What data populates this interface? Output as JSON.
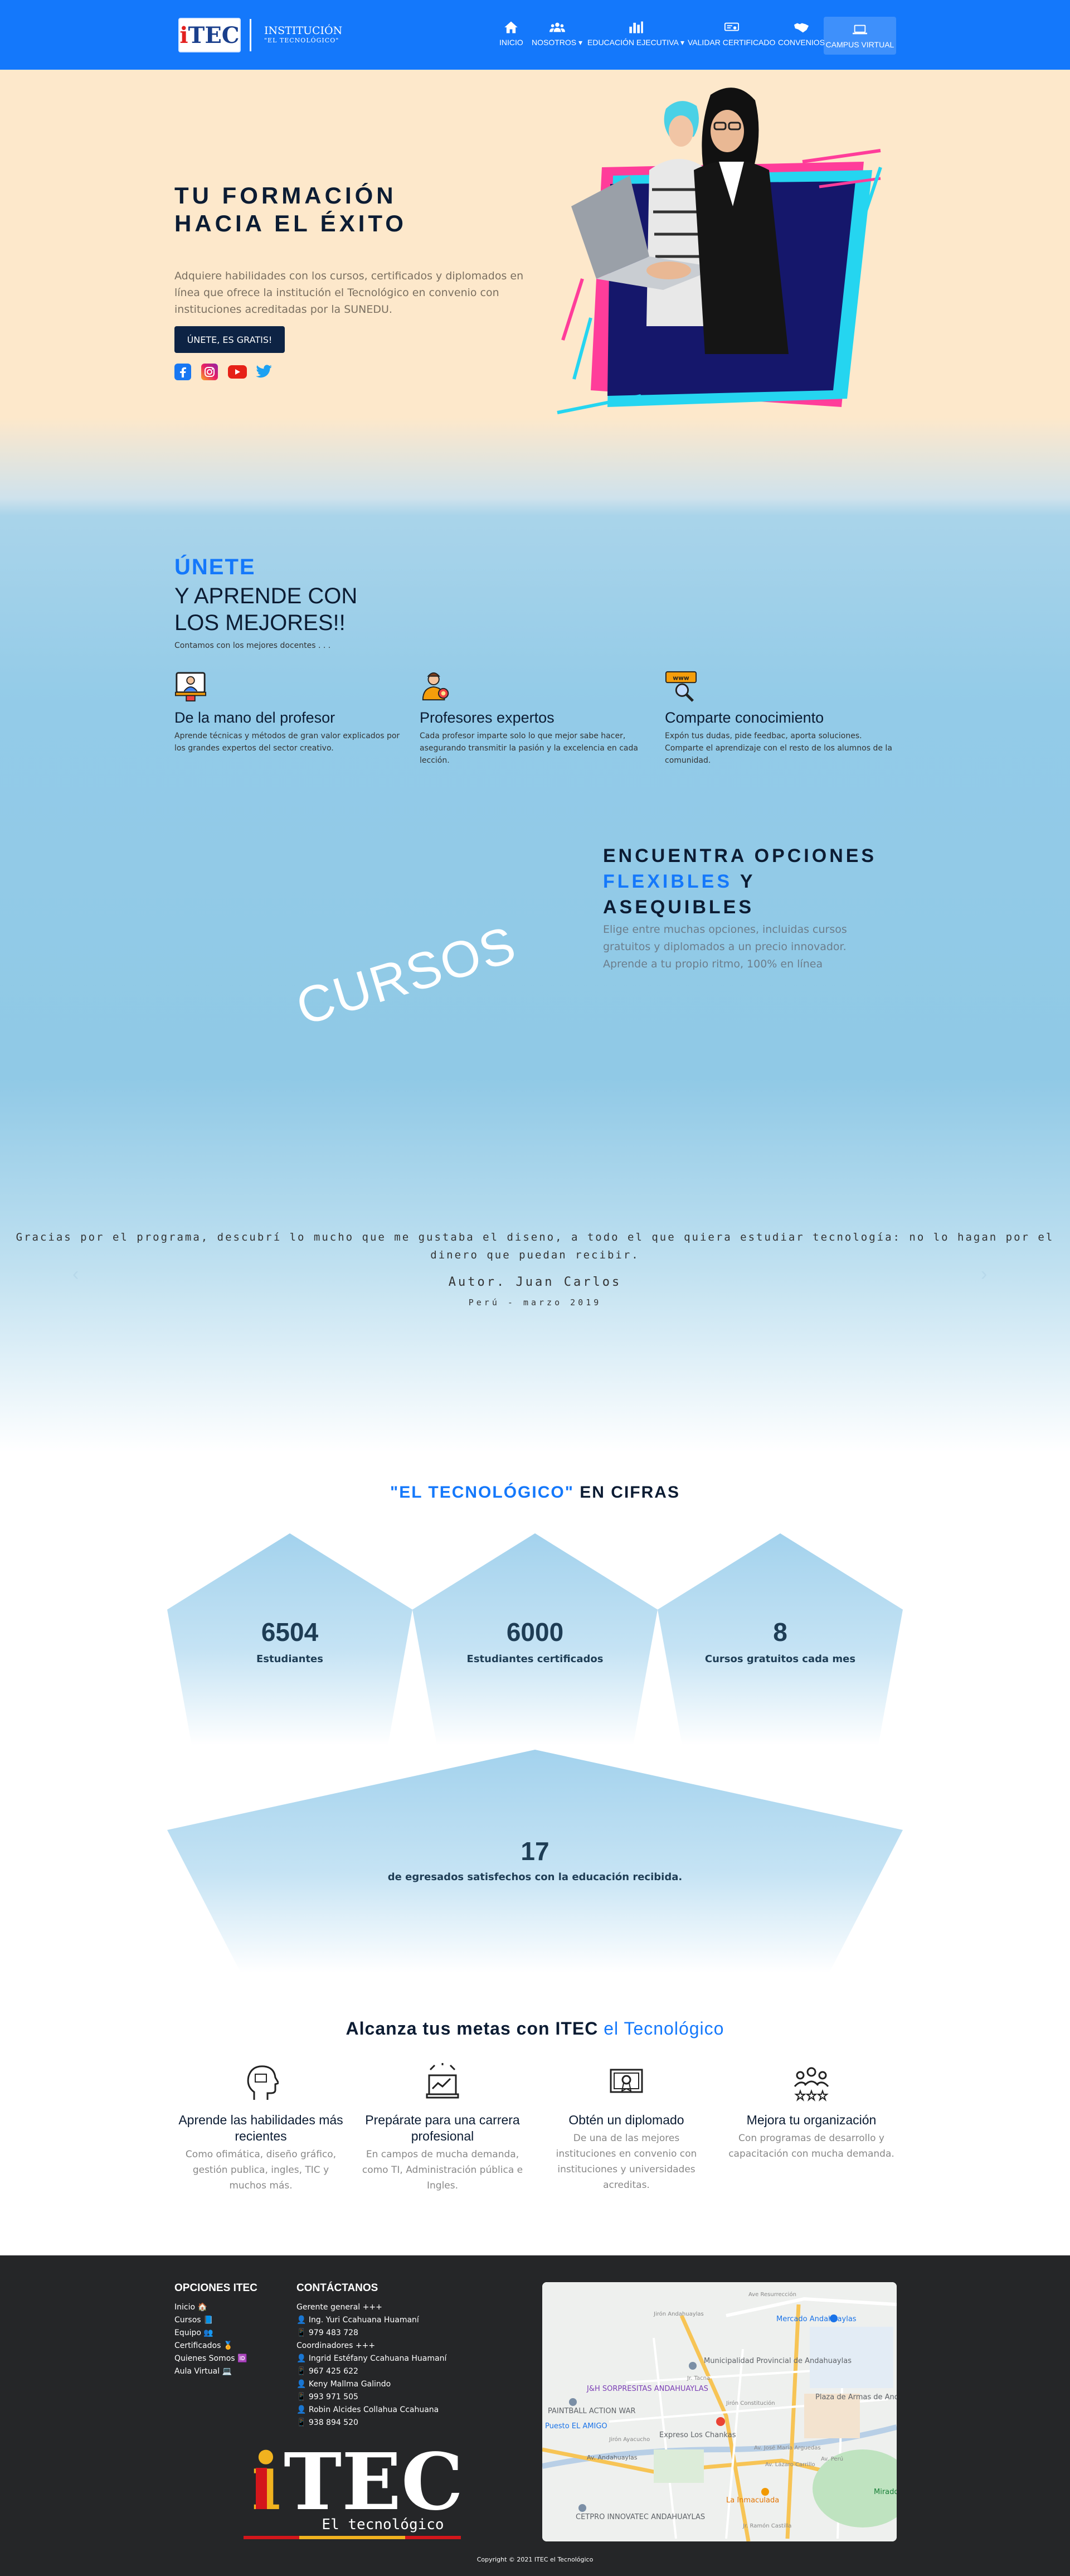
{
  "nav": {
    "logo_i": "i",
    "logo_tec": "TEC",
    "institution": "INSTITUCIÓN",
    "institution_sub": "\"EL TECNOLÓGICO\"",
    "items": [
      {
        "label": "INICIO",
        "icon": "home-icon"
      },
      {
        "label": "NOSOTROS ▾",
        "icon": "users-icon"
      },
      {
        "label": "EDUCACIÓN EJECUTIVA ▾",
        "icon": "bar-chart-icon"
      },
      {
        "label": "VALIDAR CERTIFICADO",
        "icon": "certificate-icon"
      },
      {
        "label": "CONVENIOS",
        "icon": "handshake-icon"
      },
      {
        "label": "CAMPUS VIRTUAL",
        "icon": "laptop-icon"
      }
    ],
    "color": "#1478fb"
  },
  "hero": {
    "title": "TU FORMACIÓN HACIA EL ÉXITO",
    "description": "Adquiere habilidades con los cursos, certificados y diplomados en línea que ofrece la institución el Tecnológico en convenio con instituciones acreditadas por la SUNEDU.",
    "button": "ÚNETE, ES GRATIS!",
    "social": [
      "facebook-icon",
      "instagram-icon",
      "youtube-icon",
      "twitter-icon"
    ]
  },
  "join": {
    "highlight": "ÚNETE",
    "title": "Y APRENDE CON LOS MEJORES!!",
    "subtitle": "Contamos con los mejores docentes . . .",
    "features": [
      {
        "title": "De la mano del profesor",
        "text": "Aprende técnicas y métodos de gran valor explicados por los grandes expertos del sector creativo."
      },
      {
        "title": "Profesores expertos",
        "text": "Cada profesor imparte solo lo que mejor sabe hacer, asegurando transmitir la pasión y la excelencia en cada lección."
      },
      {
        "title": "Comparte conocimiento",
        "text": "Expón tus dudas, pide feedbac, aporta soluciones. Comparte el aprendizaje con el resto de los alumnos de la comunidad."
      }
    ]
  },
  "options": {
    "title_1": "ENCUENTRA OPCIONES",
    "title_hl": "FLEXIBLES",
    "title_2": " Y",
    "title_3": "ASEQUIBLES",
    "description": "Elige entre muchas opciones, incluidas cursos gratuitos y diplomados a un precio innovador. Aprende a tu propio ritmo, 100% en línea",
    "cursos": "CURSOS"
  },
  "testimonial": {
    "quote": "Gracias por el programa, descubrí lo mucho que me gustaba el diseno, a todo el que quiera estudiar tecnología: no lo hagan por el dinero que puedan recibir.",
    "author": "Autor. Juan Carlos",
    "place": "Perú - marzo 2019",
    "prev": "‹",
    "next": "›"
  },
  "cifras": {
    "title_hl": "\"EL TECNOLÓGICO\"",
    "title_rest": " EN CIFRAS",
    "items": [
      {
        "number": "6504",
        "label": "Estudiantes"
      },
      {
        "number": "6000",
        "label": "Estudiantes certificados"
      },
      {
        "number": "8",
        "label": "Cursos gratuitos cada mes"
      }
    ],
    "big": {
      "number": "17",
      "label": "de egresados satisfechos con la educación recibida."
    }
  },
  "metas": {
    "title": "Alcanza tus metas con ITEC ",
    "title_hl": "el Tecnológico",
    "items": [
      {
        "title": "Aprende las habilidades más recientes",
        "text": "Como ofimática, diseño gráfico, gestión publica, ingles, TIC y muchos más."
      },
      {
        "title": "Prepárate para una carrera profesional",
        "text": "En campos de mucha demanda, como TI, Administración pública e Ingles."
      },
      {
        "title": "Obtén un diplomado",
        "text": "De una de las mejores instituciones en convenio con instituciones y universidades acreditas."
      },
      {
        "title": "Mejora tu organización",
        "text": "Con programas de desarrollo y capacitación con mucha demanda."
      }
    ]
  },
  "footer": {
    "options_title": "OPCIONES ITEC",
    "links": [
      "Inicio 🏠",
      "Cursos 📘",
      "Equipo 👥",
      "Certificados 🏅",
      "Quienes Somos 🆔",
      "Aula Virtual 💻"
    ],
    "contact_title": "CONTÁCTANOS",
    "contacts": [
      "Gerente general +++",
      "👤 Ing. Yuri Ccahuana Huamaní",
      "📱 979 483 728",
      "Coordinadores +++",
      "👤 Ingrid Estéfany Ccahuana Huamaní",
      "📱 967 425 622",
      "👤 Keny Mallma Galindo",
      "📱 993 971 505",
      "👤 Robin Alcides Collahua Ccahuana",
      "📱 938 894 520"
    ],
    "logo_i": "i",
    "logo_tec": "TEC",
    "logo_sub": "El tecnológico",
    "map_labels": [
      "Mercado Andahuaylas",
      "Municipalidad Provincial de Andahuaylas",
      "J&H SORPRESITAS ANDAHUAYLAS",
      "Plaza de Armas de Andahuaylas",
      "PAINTBALL ACTION WAR",
      "Puesto EL AMIGO",
      "Expreso Los Chankas",
      "Av. Andahuaylas",
      "CETPRO INNOVATEC ANDAHUAYLAS",
      "La Inmaculada",
      "Mirador",
      "Jirón Ayacucho",
      "Av. José Maria Arguedas",
      "Av. Lázaro Carrillo",
      "Av. Perú",
      "Jr. Ramón Castilla",
      "Jr. Tacna",
      "Jirón Constitución",
      "Jirón Andahuaylas",
      "Ave Resurrección"
    ],
    "copyright": "Copyright © 2021 ITEC el Tecnológico"
  }
}
